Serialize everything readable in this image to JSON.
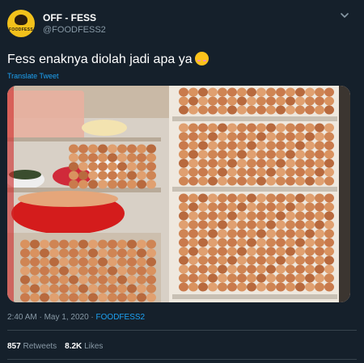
{
  "author": {
    "display_name": "OFF - FESS",
    "handle": "@FOODFESS2",
    "avatar_text": "FOODFESS"
  },
  "tweet": {
    "text": "Fess enaknya diolah jadi apa ya",
    "emoji": "smiling-face-with-blush",
    "translate_label": "Translate Tweet",
    "media_alt": "Refrigerator packed with eggs on every shelf and door"
  },
  "meta": {
    "time": "2:40 AM",
    "separator": " · ",
    "date": "May 1, 2020",
    "source": "FOODFESS2"
  },
  "stats": {
    "retweets_count": "857",
    "retweets_label": "Retweets",
    "likes_count": "8.2K",
    "likes_label": "Likes"
  },
  "colors": {
    "background": "#15202b",
    "secondary_text": "#8899a6",
    "link": "#1da1f2",
    "divider": "#38444d",
    "avatar_bg": "#f2c11b"
  }
}
